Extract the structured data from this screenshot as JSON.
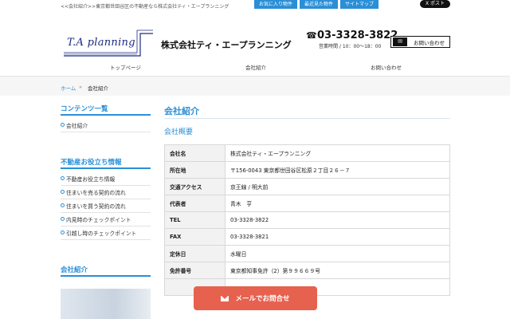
{
  "topbar": {
    "tagline": "<<会社紹介>>東京都世田谷区の不動産なら株式会社ティ・エープランニング",
    "links": [
      "お気に入り物件",
      "最近見た物件",
      "サイトマップ"
    ],
    "x_post": "X ポスト"
  },
  "header": {
    "logo_text": "T.A planning",
    "company_name": "株式会社ティ・エープランニング",
    "phone": "03-3328-3822",
    "hours": "営業時間 / 10：00～18：00",
    "contact_button": "お問い合わせ"
  },
  "gnav": [
    "トップページ",
    "会社紹介",
    "お問い合わせ"
  ],
  "breadcrumb": {
    "home": "ホーム",
    "sep": "»",
    "current": "会社紹介"
  },
  "sidebar": {
    "contents_title": "コンテンツ一覧",
    "contents_items": [
      "会社紹介"
    ],
    "info_title": "不動産お役立ち情報",
    "info_items": [
      "不動産お役立ち情報",
      "住まいを売る契約の流れ",
      "住まいを買う契約の流れ",
      "内見時のチェックポイント",
      "引越し時のチェックポイント"
    ],
    "company_title": "会社紹介"
  },
  "main": {
    "title": "会社紹介",
    "subtitle": "会社概要",
    "rows": [
      {
        "key": "会社名",
        "value": "株式会社ティ・エープランニング"
      },
      {
        "key": "所在地",
        "value": "〒156-0043 東京都世田谷区松原２丁目２６－７"
      },
      {
        "key": "交通アクセス",
        "value": "京王線 / 明大前"
      },
      {
        "key": "代表者",
        "value": "青木　亨"
      },
      {
        "key": "TEL",
        "value": "03-3328-3822"
      },
      {
        "key": "FAX",
        "value": "03-3328-3821"
      },
      {
        "key": "定休日",
        "value": "水曜日"
      },
      {
        "key": "免許番号",
        "value": "東京都知事免許（2）第９９６６９号"
      }
    ]
  },
  "floating_button": "メールでお問合せ",
  "colors": {
    "accent": "#2a8fd6",
    "cta": "#e7614f"
  }
}
